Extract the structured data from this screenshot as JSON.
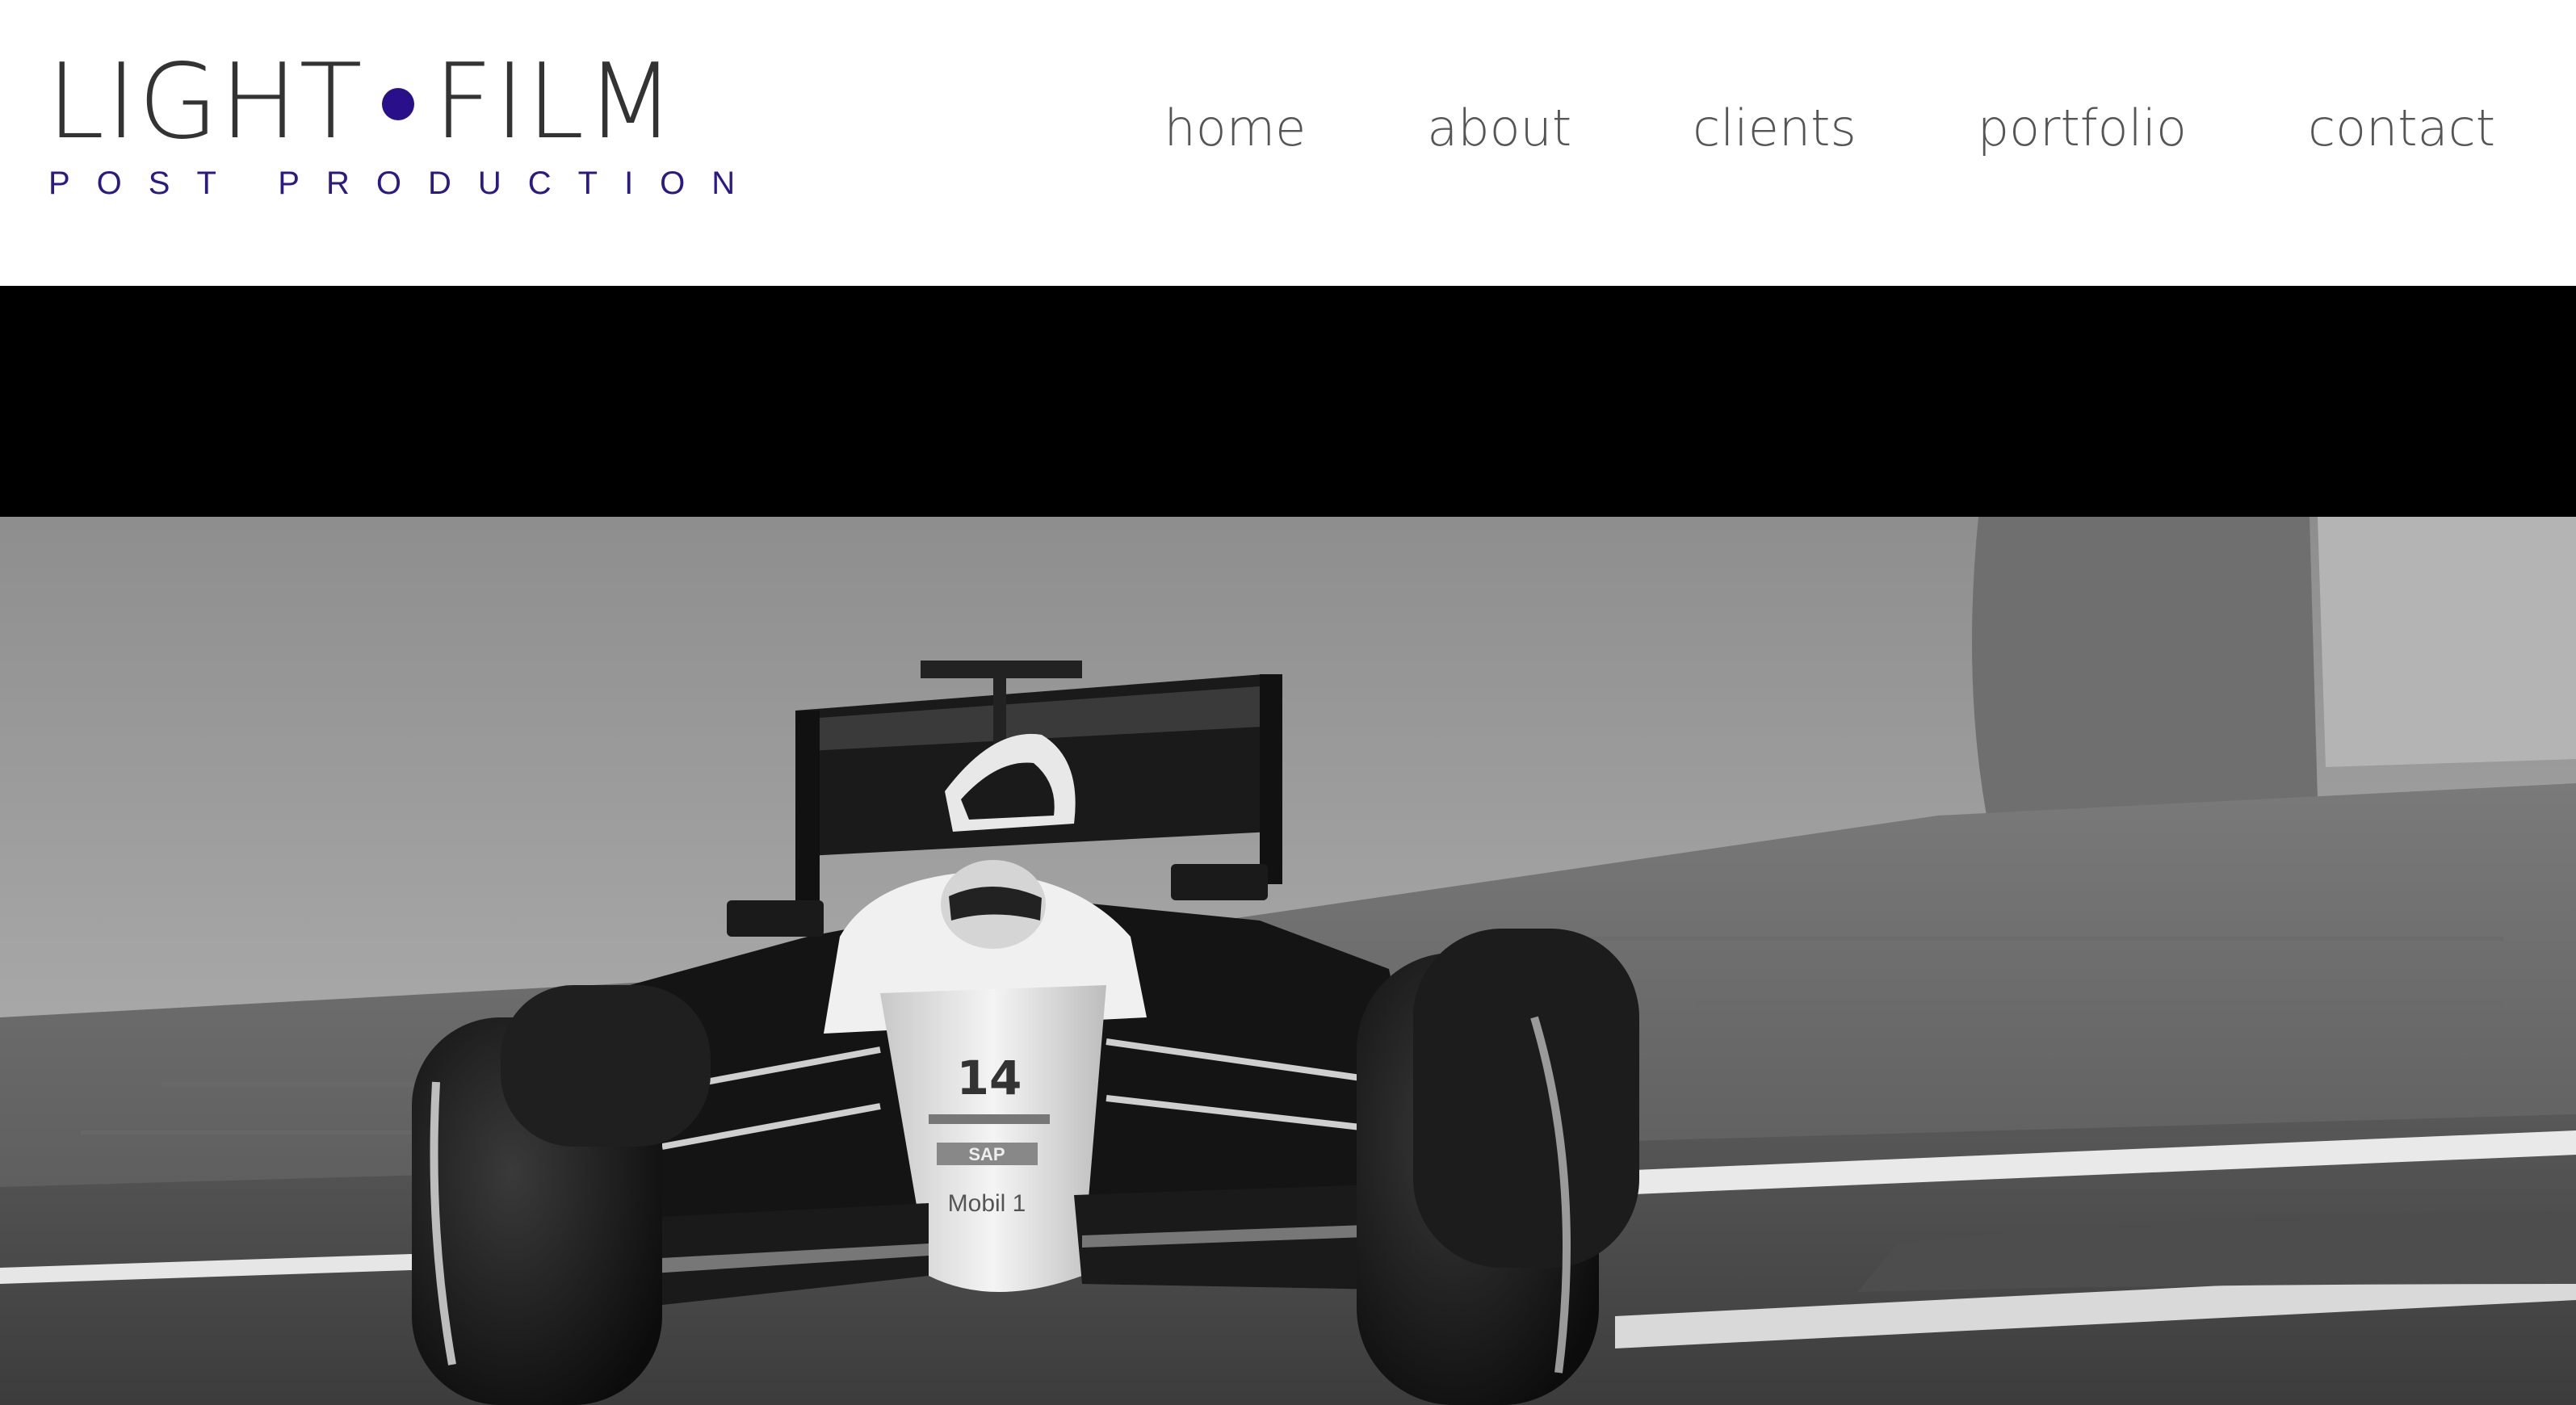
{
  "logo": {
    "word1": "LIGHT",
    "word2": "FILM",
    "subtitle": "POST PRODUCTION",
    "dot_color": "#2a0f8a",
    "subtitle_color": "#2a1a86"
  },
  "nav": {
    "items": [
      {
        "label": "home"
      },
      {
        "label": "about"
      },
      {
        "label": "clients"
      },
      {
        "label": "portfolio"
      },
      {
        "label": "contact"
      }
    ]
  },
  "hero": {
    "car_number": "14",
    "sponsor_1": "SAP",
    "sponsor_2": "Mobil 1"
  }
}
